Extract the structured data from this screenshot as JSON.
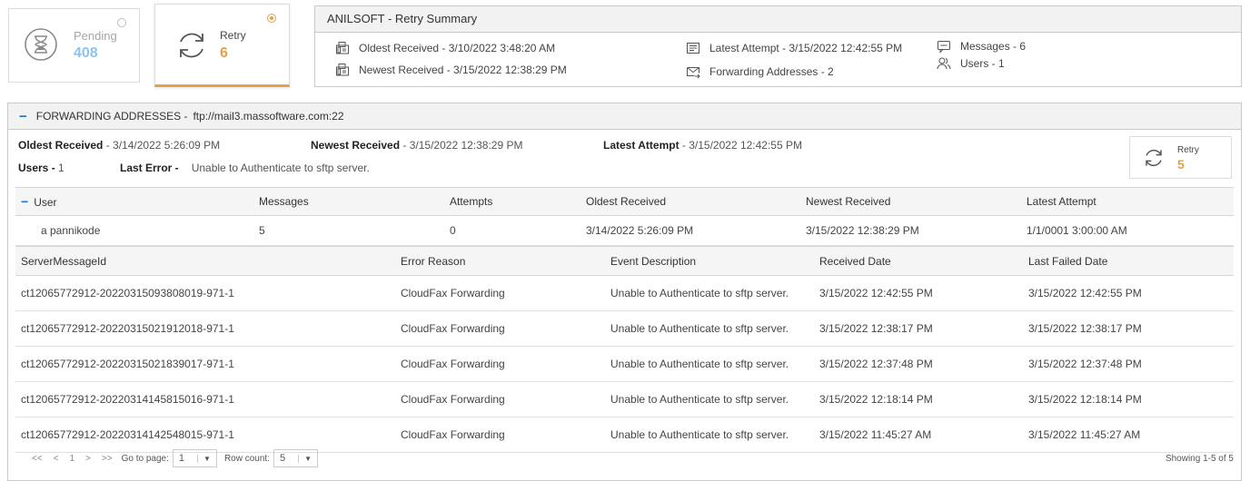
{
  "colors": {
    "accent": "#e3a04a",
    "pending_blue": "#8ec3f0",
    "link_blue": "#1a73c9"
  },
  "cards": {
    "pending": {
      "label": "Pending",
      "value": "408",
      "icon": "hourglass-icon"
    },
    "retry": {
      "label": "Retry",
      "value": "6",
      "icon": "refresh-icon"
    }
  },
  "summary": {
    "title": "ANILSOFT - Retry Summary",
    "oldest_received": "Oldest Received - 3/10/2022 3:48:20 AM",
    "newest_received": "Newest Received - 3/15/2022 12:38:29 PM",
    "latest_attempt": "Latest Attempt - 3/15/2022 12:42:55 PM",
    "forwarding_addresses": "Forwarding Addresses - 2",
    "messages": "Messages - 6",
    "users": "Users - 1"
  },
  "forwarding": {
    "title": "FORWARDING ADDRESSES -",
    "url": "ftp://mail3.massoftware.com:22",
    "oldest_label": "Oldest Received",
    "oldest_value": " - 3/14/2022 5:26:09 PM",
    "newest_label": "Newest Received",
    "newest_value": " - 3/15/2022 12:38:29 PM",
    "latest_label": "Latest Attempt",
    "latest_value": " - 3/15/2022 12:42:55 PM",
    "users_label": "Users -",
    "users_value": " 1",
    "last_error_label": "Last Error -",
    "last_error_value": "Unable to Authenticate to sftp server.",
    "retry_label": "Retry",
    "retry_value": "5"
  },
  "user_table": {
    "headers": [
      "User",
      "Messages",
      "Attempts",
      "Oldest Received",
      "Newest Received",
      "Latest Attempt"
    ],
    "rows": [
      [
        "a pannikode",
        "5",
        "0",
        "3/14/2022 5:26:09 PM",
        "3/15/2022 12:38:29 PM",
        "1/1/0001 3:00:00 AM"
      ]
    ]
  },
  "message_table": {
    "headers": [
      "ServerMessageId",
      "Error Reason",
      "Event Description",
      "Received Date",
      "Last Failed Date"
    ],
    "rows": [
      [
        "ct12065772912-20220315093808019-971-1",
        "CloudFax Forwarding",
        "Unable to Authenticate to sftp server.",
        "3/15/2022 12:42:55 PM",
        "3/15/2022 12:42:55 PM"
      ],
      [
        "ct12065772912-20220315021912018-971-1",
        "CloudFax Forwarding",
        "Unable to Authenticate to sftp server.",
        "3/15/2022 12:38:17 PM",
        "3/15/2022 12:38:17 PM"
      ],
      [
        "ct12065772912-20220315021839017-971-1",
        "CloudFax Forwarding",
        "Unable to Authenticate to sftp server.",
        "3/15/2022 12:37:48 PM",
        "3/15/2022 12:37:48 PM"
      ],
      [
        "ct12065772912-20220314145815016-971-1",
        "CloudFax Forwarding",
        "Unable to Authenticate to sftp server.",
        "3/15/2022 12:18:14 PM",
        "3/15/2022 12:18:14 PM"
      ],
      [
        "ct12065772912-20220314142548015-971-1",
        "CloudFax Forwarding",
        "Unable to Authenticate to sftp server.",
        "3/15/2022 11:45:27 AM",
        "3/15/2022 11:45:27 AM"
      ]
    ]
  },
  "pager": {
    "first": "<<",
    "prev": "<",
    "page": "1",
    "next": ">",
    "last": ">>",
    "goto_label": "Go to page:",
    "goto_value": "1",
    "rowcount_label": "Row count:",
    "rowcount_value": "5",
    "showing": "Showing 1-5 of 5"
  }
}
